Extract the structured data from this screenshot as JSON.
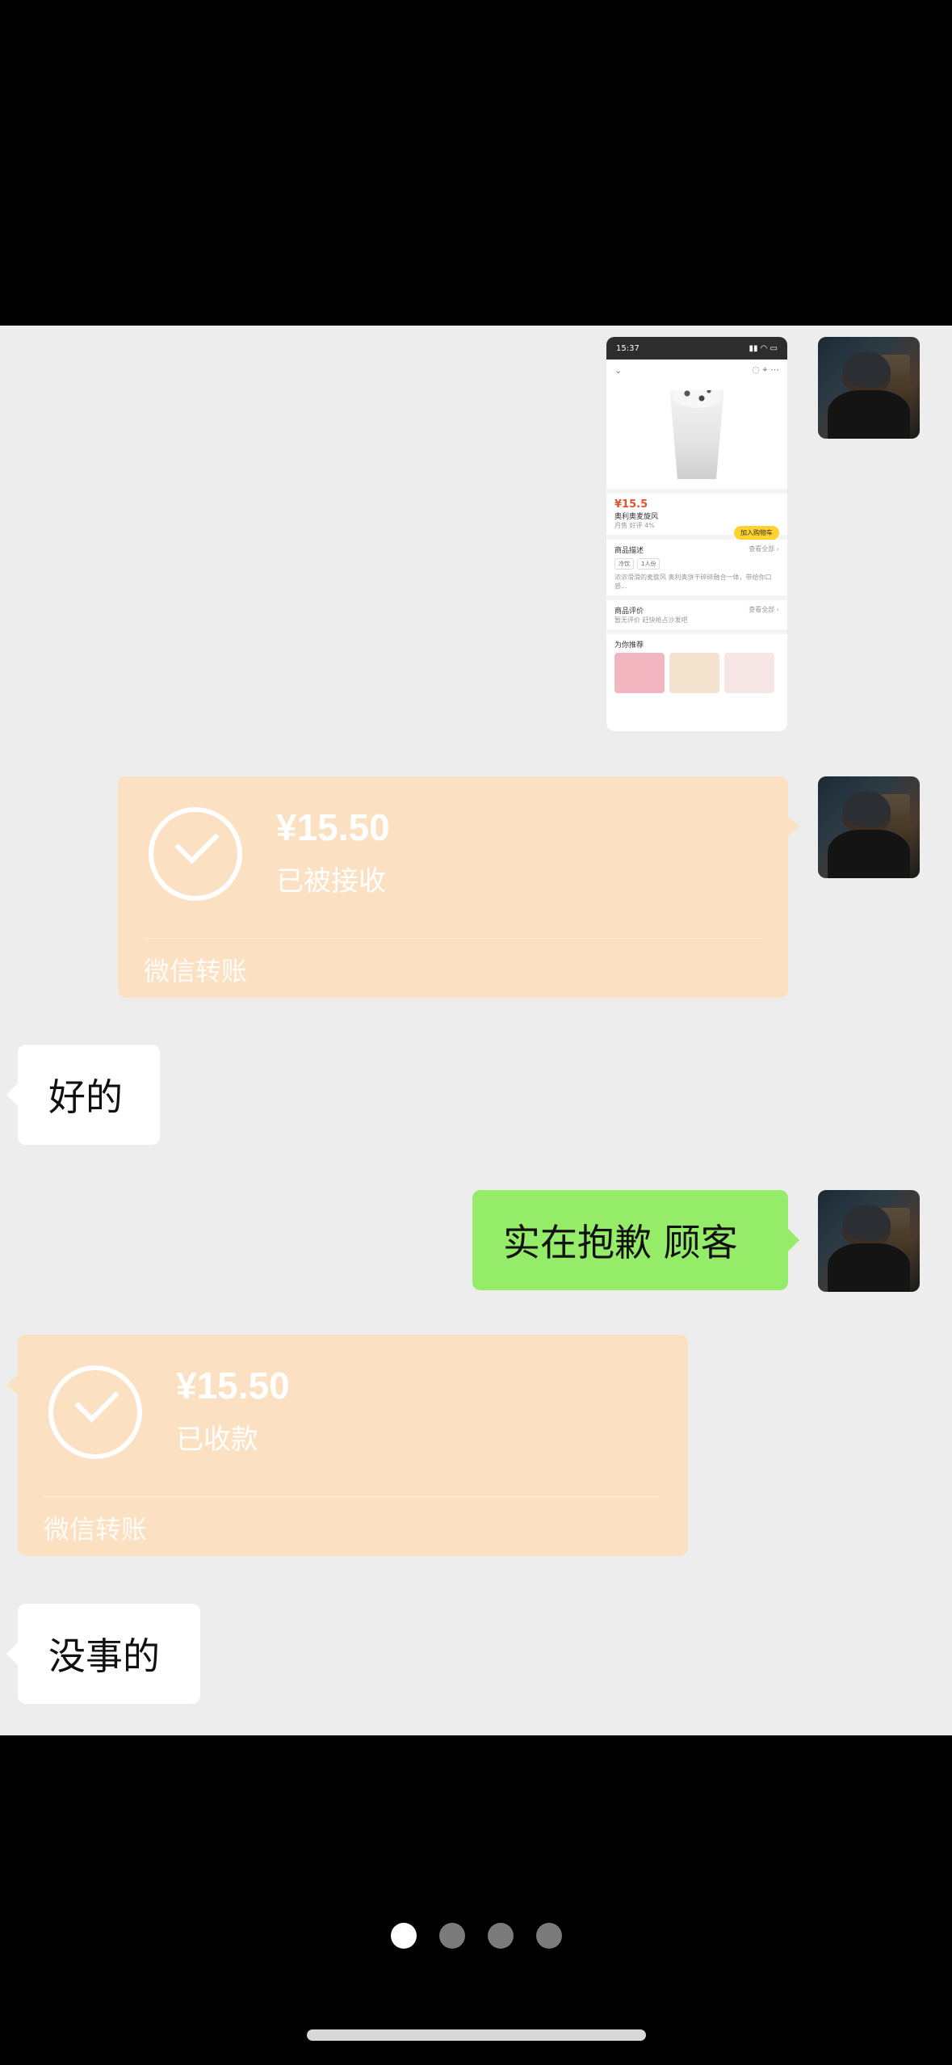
{
  "screenshot": {
    "time": "15:37",
    "price_symbol": "¥",
    "price": "15.5",
    "product_name": "奥利奥麦旋风",
    "product_meta": "月售  好评 4%",
    "add_to_cart": "加入购物车",
    "desc_title": "商品描述",
    "desc_link": "查看全部 ›",
    "chip_1": "冷饮",
    "chip_2": "1人份",
    "desc_text": "浓浓滑滑的麦旋风 奥利奥饼干碎碎融合一体，带给你口感...",
    "review_title": "商品评价",
    "review_link": "查看全部 ›",
    "review_text": "暂无评价 赶快抢占沙发吧",
    "recommend_title": "为你推荐"
  },
  "messages": {
    "transfer_1": {
      "amount": "¥15.50",
      "status": "已被接收",
      "footer": "微信转账"
    },
    "reply_1": "好的",
    "sent_1": "实在抱歉 顾客",
    "transfer_2": {
      "amount": "¥15.50",
      "status": "已收款",
      "footer": "微信转账"
    },
    "reply_2": "没事的"
  },
  "pager": {
    "total": 4,
    "active": 1
  },
  "colors": {
    "transfer_bg": "#fbe0c2",
    "sent_bubble": "#95ec69",
    "chat_bg": "#ededed"
  }
}
